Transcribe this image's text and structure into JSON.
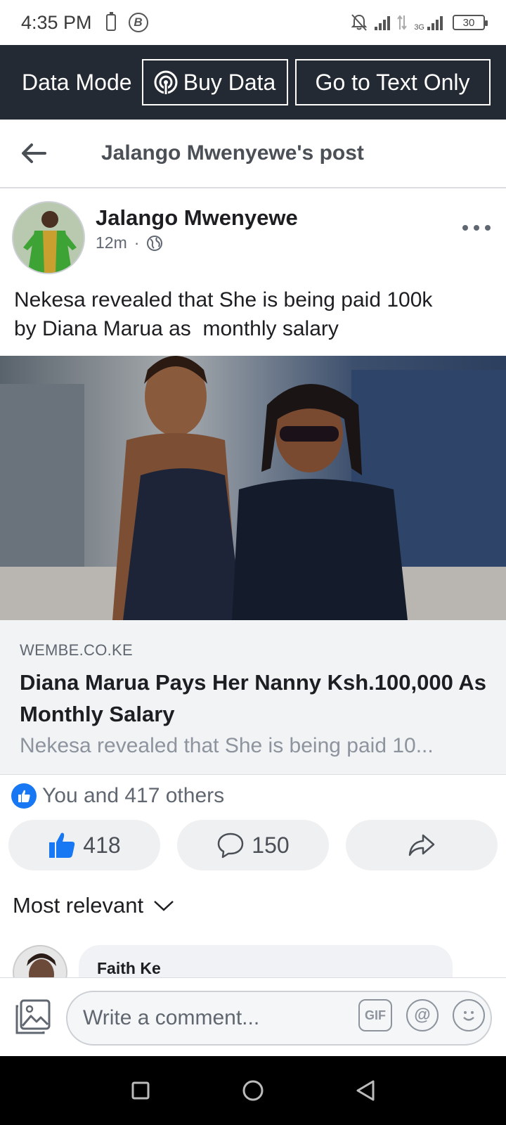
{
  "status_bar": {
    "time": "4:35 PM",
    "network_label": "3G",
    "battery": "30"
  },
  "data_bar": {
    "mode_label": "Data Mode",
    "buy_data_label": "Buy Data",
    "text_only_label": "Go to Text Only"
  },
  "header": {
    "title": "Jalango Mwenyewe's post"
  },
  "post": {
    "author": "Jalango Mwenyewe",
    "time_ago": "12m",
    "meta_separator": "·",
    "text": "Nekesa revealed that She is being paid 100k\nby Diana Marua as  monthly salary",
    "link": {
      "domain": "WEMBE.CO.KE",
      "title": "Diana Marua Pays Her Nanny Ksh.100,000 As Monthly Salary",
      "description": "Nekesa revealed that She is being paid 10..."
    },
    "reactions_summary": "You and 417 others",
    "like_count": "418",
    "comment_count": "150"
  },
  "comments": {
    "sort_label": "Most relevant",
    "first_author": "Faith Ke"
  },
  "composer": {
    "placeholder": "Write a comment...",
    "gif_label": "GIF",
    "at_label": "@"
  },
  "colors": {
    "facebook_blue": "#1877f2",
    "data_bar_bg": "#242a33"
  }
}
